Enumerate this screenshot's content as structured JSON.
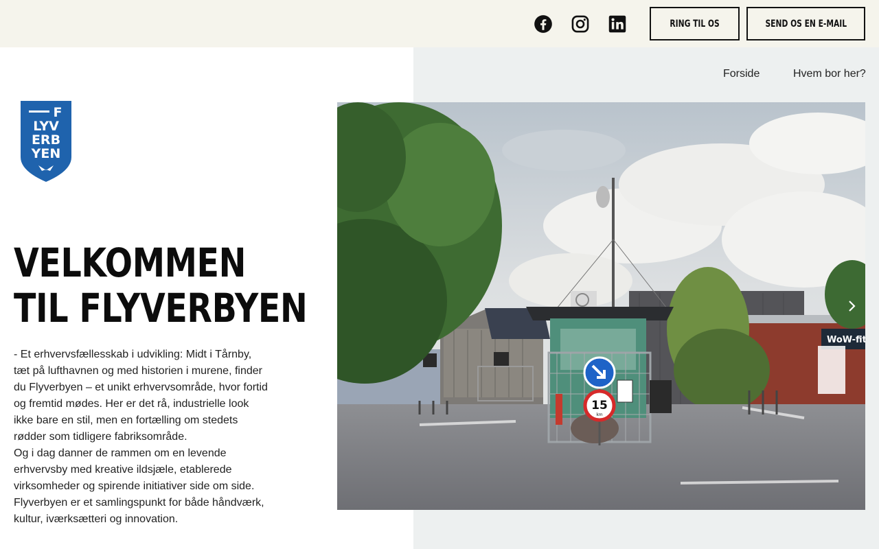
{
  "header": {
    "social": [
      {
        "name": "facebook-icon"
      },
      {
        "name": "instagram-icon"
      },
      {
        "name": "linkedin-icon"
      }
    ],
    "call_label": "RING TIL OS",
    "email_label": "SEND OS EN E-MAIL"
  },
  "nav": {
    "items": [
      "Forside",
      "Hvem bor her?"
    ]
  },
  "logo": {
    "letters": [
      "F",
      "LYV",
      "ERB",
      "YEN"
    ]
  },
  "hero": {
    "title_line1": "VELKOMMEN",
    "title_line2": "TIL FLYVERBYEN",
    "paragraphs": [
      "- Et erhvervsfællesskab i udvikling: Midt i Tårnby, tæt på lufthavnen og med historien i murene, finder du Flyverbyen – et unikt erhvervsområde, hvor fortid og fremtid mødes. Her er det rå, industrielle look ikke bare en stil, men en fortælling om stedets rødder som tidligere fabriksområde.",
      "Og i dag danner de rammen om en levende erhvervsby med kreative ildsjæle, etablerede virksomheder og spirende initiativer side om side. Flyverbyen er et samlingspunkt for både håndværk, kultur, iværksætteri og innovation."
    ]
  },
  "photo": {
    "speed_sign": "15",
    "speed_unit": "km",
    "shop_sign": "WoW-fit"
  },
  "colors": {
    "topbar": "#f5f4ec",
    "panel": "#edf0f0",
    "logo_blue": "#1f63ad"
  }
}
